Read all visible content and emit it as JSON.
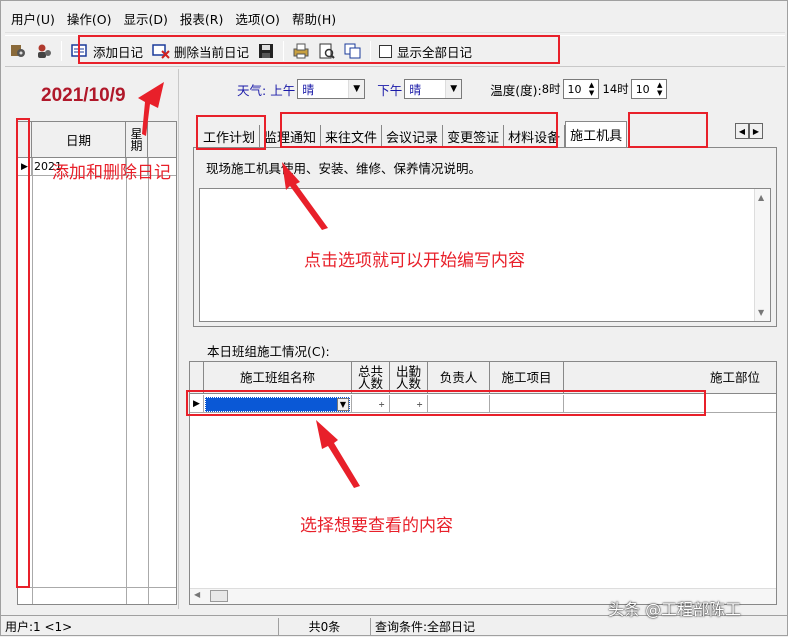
{
  "menu": [
    "用户(U)",
    "操作(O)",
    "显示(D)",
    "报表(R)",
    "选项(O)",
    "帮助(H)"
  ],
  "toolbar": {
    "add_diary": "添加日记",
    "delete_diary": "删除当前日记",
    "show_all": "显示全部日记"
  },
  "left": {
    "date": "2021/10/9",
    "col_date": "日期",
    "col_week": "星期",
    "row_date": "2021"
  },
  "weather": {
    "label": "天气:",
    "am_label": "上午",
    "am_value": "晴",
    "pm_label": "下午",
    "pm_value": "晴",
    "temp_label": "温度(度):",
    "t8_label": "8时",
    "t8_value": "10",
    "t14_label": "14时",
    "t14_value": "10"
  },
  "tabs": [
    "工作计划",
    "监理通知",
    "来往文件",
    "会议记录",
    "变更签证",
    "材料设备",
    "施工机具"
  ],
  "active_tab": "施工机具",
  "tab_desc": "现场施工机具使用、安装、维修、保养情况说明。",
  "team": {
    "label": "本日班组施工情况(C):",
    "headers": [
      "施工班组名称",
      "总共人数",
      "出勤人数",
      "负责人",
      "施工项目",
      "施工部位"
    ]
  },
  "status": {
    "user": "用户:1 <1>",
    "count": "共0条",
    "query": "查询条件:全部日记"
  },
  "annotations": {
    "add_delete": "添加和删除日记",
    "click_tab": "点击选项就可以开始编写内容",
    "select_view": "选择想要查看的内容"
  },
  "watermark": "头条 @工程部陈工",
  "colors": {
    "annotation": "#e8202a",
    "date": "#b0182a",
    "weather_label": "#1a1aa8"
  }
}
